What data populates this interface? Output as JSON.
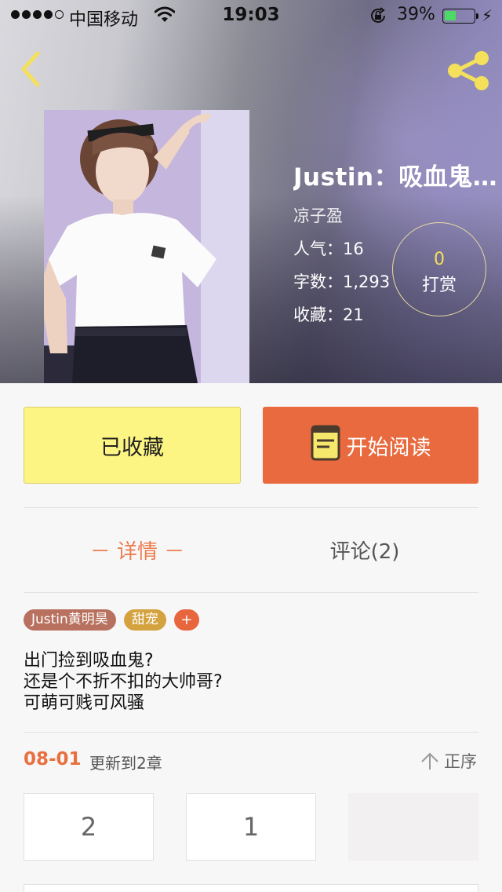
{
  "status_bar": {
    "carrier": "中国移动",
    "time": "19:03",
    "battery_percent": "39%",
    "battery_level": 0.39,
    "signal_bars_filled": 4,
    "signal_bars_total": 5
  },
  "nav": {
    "back_icon": "chevron-left-icon",
    "share_icon": "share-icon",
    "icon_color": "#f4e05a"
  },
  "book": {
    "title": "Justin：吸血鬼…",
    "author": "凉子盈",
    "popularity": "人气：16",
    "word_count": "字数：1,293",
    "favorites": "收藏：21"
  },
  "tip": {
    "count": "0",
    "label": "打赏"
  },
  "actions": {
    "favorited_label": "已收藏",
    "read_label": "开始阅读"
  },
  "tabs": {
    "details": "－ 详情 －",
    "comments": "评论(2)"
  },
  "tags": [
    "Justin黄明昊",
    "甜宠"
  ],
  "tag_add": "+",
  "summary": [
    "出门捡到吸血鬼?",
    "还是个不折不扣的大帅哥?",
    "可萌可贱可风骚"
  ],
  "updates": {
    "date": "08-01",
    "text": "更新到2章",
    "sort_label": "正序"
  },
  "chapters": [
    "2",
    "1"
  ],
  "colors": {
    "accent_orange": "#e86a3e",
    "fav_yellow": "#fdf583",
    "tag_brown": "#b8715f",
    "tag_gold": "#d4a23e"
  }
}
